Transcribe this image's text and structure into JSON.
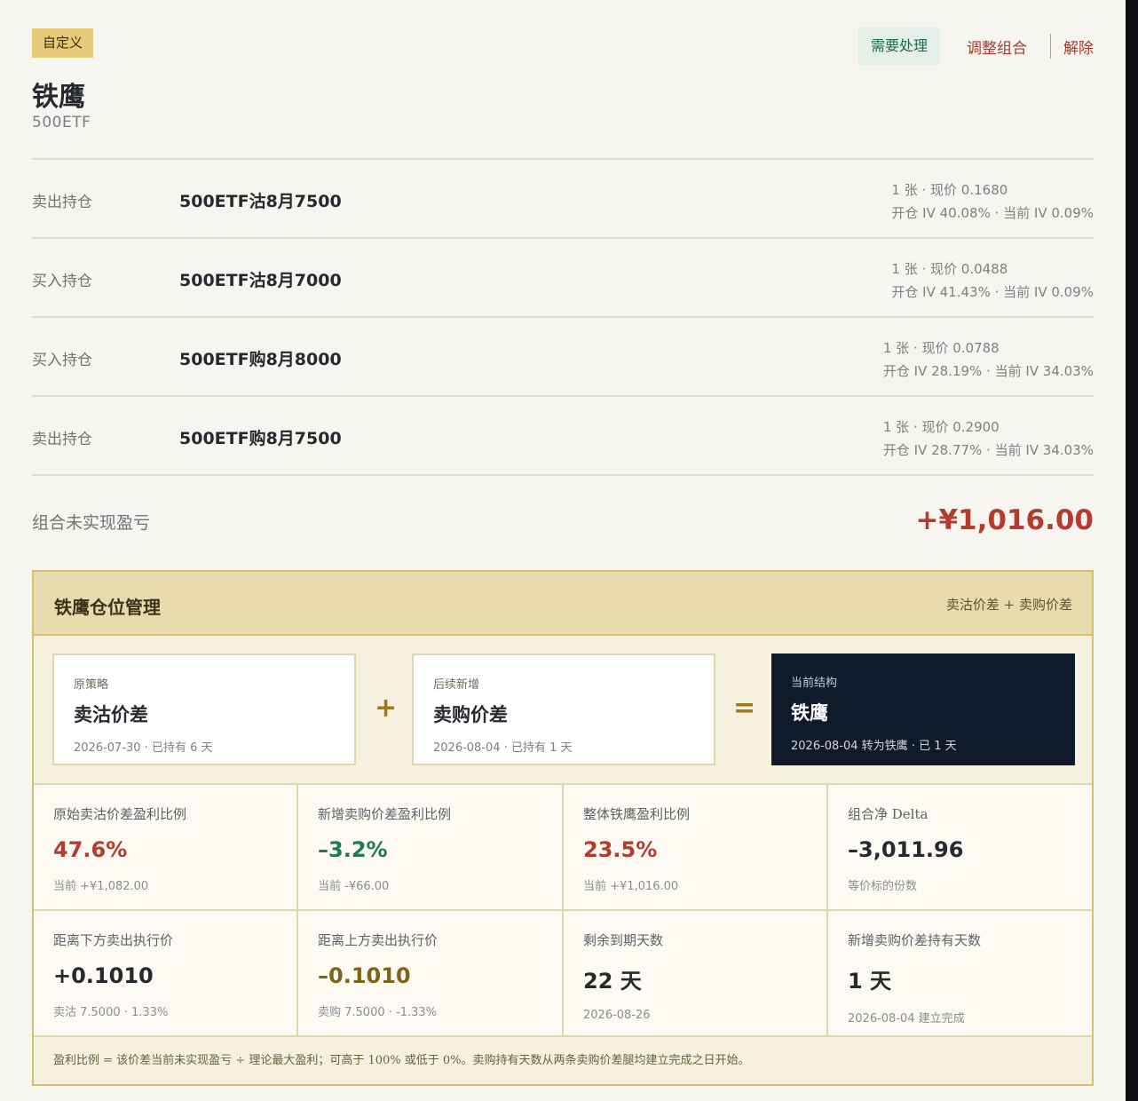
{
  "header": {
    "tag": "自定义",
    "title": "铁鹰",
    "underlying": "500ETF",
    "actions": {
      "need": "需要处理",
      "adjust": "调整组合",
      "dissolve": "解除"
    }
  },
  "positions": [
    {
      "side": "卖出持仓",
      "name": "500ETF沽8月7500",
      "line1": "1 张 · 现价 0.1680",
      "line2": "开仓 IV 40.08% · 当前 IV 0.09%"
    },
    {
      "side": "买入持仓",
      "name": "500ETF沽8月7000",
      "line1": "1 张 · 现价 0.0488",
      "line2": "开仓 IV 41.43% · 当前 IV 0.09%"
    },
    {
      "side": "买入持仓",
      "name": "500ETF购8月8000",
      "line1": "1 张 · 现价 0.0788",
      "line2": "开仓 IV 28.19% · 当前 IV 34.03%"
    },
    {
      "side": "卖出持仓",
      "name": "500ETF购8月7500",
      "line1": "1 张 · 现价 0.2900",
      "line2": "开仓 IV 28.77% · 当前 IV 34.03%"
    }
  ],
  "pnl": {
    "label": "组合未实现盈亏",
    "value": "+¥1,016.00"
  },
  "panel": {
    "title": "铁鹰仓位管理",
    "hint": "卖沽价差 + 卖购价差",
    "structures": [
      {
        "label": "原策略",
        "name": "卖沽价差",
        "date": "2026-07-30 · 已持有 6 天"
      },
      {
        "label": "后续新增",
        "name": "卖购价差",
        "date": "2026-08-04 · 已持有 1 天"
      },
      {
        "label": "当前结构",
        "name": "铁鹰",
        "date": "2026-08-04 转为铁鹰 · 已 1 天"
      }
    ],
    "plus": "+",
    "equals": "=",
    "metrics": [
      {
        "label": "原始卖沽价差盈利比例",
        "value": "47.6%",
        "sub": "当前 +¥1,082.00"
      },
      {
        "label": "新增卖购价差盈利比例",
        "value": "–3.2%",
        "sub": "当前 -¥66.00"
      },
      {
        "label": "整体铁鹰盈利比例",
        "value": "23.5%",
        "sub": "当前 +¥1,016.00"
      },
      {
        "label": "组合净 Delta",
        "value": "–3,011.96",
        "sub": "等价标的份数"
      },
      {
        "label": "距离下方卖出执行价",
        "value": "+0.1010",
        "sub": "卖沽 7.5000 · 1.33%"
      },
      {
        "label": "距离上方卖出执行价",
        "value": "–0.1010",
        "sub": "卖购 7.5000 · -1.33%"
      },
      {
        "label": "剩余到期天数",
        "value": "22 天",
        "sub": "2026-08-26"
      },
      {
        "label": "新增卖购价差持有天数",
        "value": "1 天",
        "sub": "2026-08-04 建立完成"
      }
    ],
    "footnote": "盈利比例 = 该价差当前未实现盈亏 ÷ 理论最大盈利；可高于 100% 或低于 0%。卖购持有天数从两条卖购价差腿均建立完成之日开始。"
  },
  "colors": {
    "red": "#b63b2f",
    "green": "#1f7a52",
    "olive": "#7d6515",
    "gold": "#e7c977",
    "navy": "#0f1b2a"
  }
}
